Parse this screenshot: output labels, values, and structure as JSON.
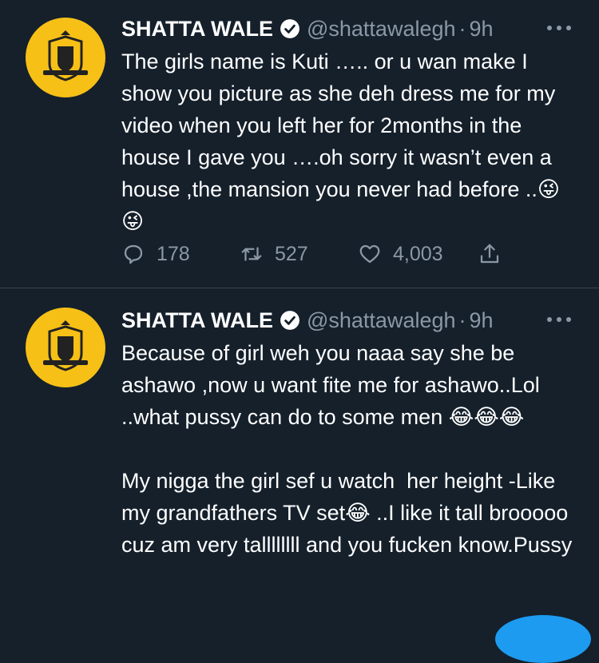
{
  "tweets": [
    {
      "author_name": "SHATTA WALE",
      "handle": "@shattawalegh",
      "separator": "·",
      "time": "9h",
      "text": "The girls name is Kuti ….. or u wan make I show you picture as she deh dress me for my video when you left her for 2months in the house I gave you ….oh sorry it wasn’t even a house ,the mansion you never had before ..😜😜",
      "reply_count": "178",
      "retweet_count": "527",
      "like_count": "4,003"
    },
    {
      "author_name": "SHATTA WALE",
      "handle": "@shattawalegh",
      "separator": "·",
      "time": "9h",
      "text": "Because of girl weh you naaa say she be ashawo ,now u want fite me for ashawo..Lol ..what pussy can do to some men 😂😂😂\n\nMy nigga the girl sef u watch  her height -Like my grandfathers TV set😂 ..I like it tall brooooo cuz am very tallllllll and you fucken know.Pussy"
    }
  ],
  "colors": {
    "background": "#15202b",
    "text_primary": "#ffffff",
    "text_secondary": "#8b98a5",
    "avatar_bg": "#f6c016",
    "accent": "#1d9bf0"
  },
  "icons": [
    "verified-badge-icon",
    "more-options-icon",
    "reply-icon",
    "retweet-icon",
    "like-icon",
    "share-icon"
  ]
}
